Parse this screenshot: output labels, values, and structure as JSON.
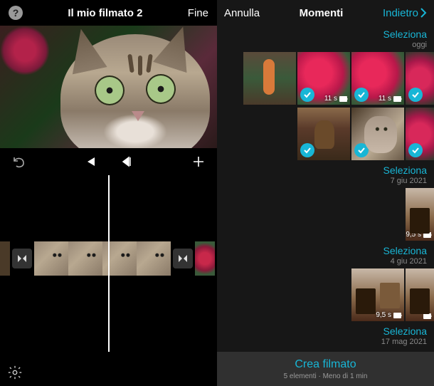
{
  "editor": {
    "title": "Il mio filmato 2",
    "done": "Fine",
    "help_glyph": "?"
  },
  "picker": {
    "back": "Indietro",
    "title": "Momenti",
    "cancel": "Annulla",
    "select_label": "Seleziona",
    "sections": [
      {
        "date": "oggi",
        "thumbs": [
          {
            "kind": "plant",
            "video": false
          },
          {
            "kind": "pink",
            "video": true,
            "dur": "11 s",
            "checked": true
          },
          {
            "kind": "pink",
            "video": true,
            "dur": "11 s",
            "checked": true
          },
          {
            "kind": "pink2",
            "video": false,
            "checked": true,
            "half": true
          }
        ],
        "row2": [
          {
            "kind": "dog",
            "video": false,
            "checked": true
          },
          {
            "kind": "catth",
            "video": false,
            "checked": true
          },
          {
            "kind": "pink2",
            "video": false,
            "checked": true,
            "half": true
          }
        ]
      },
      {
        "date": "7 giu 2021",
        "thumbs": [
          {
            "kind": "room",
            "video": true,
            "dur": "9,5 s",
            "half": true
          }
        ]
      },
      {
        "date": "4 giu 2021",
        "thumbs": [
          {
            "kind": "room",
            "video": true,
            "dur": "9,5 s"
          },
          {
            "kind": "room",
            "video": true,
            "dur": "",
            "half": true
          }
        ]
      },
      {
        "date": "17 mag 2021",
        "thumbs": []
      }
    ],
    "create": {
      "main": "Crea filmato",
      "sub": "5 elementi · Meno di 1 min"
    }
  }
}
